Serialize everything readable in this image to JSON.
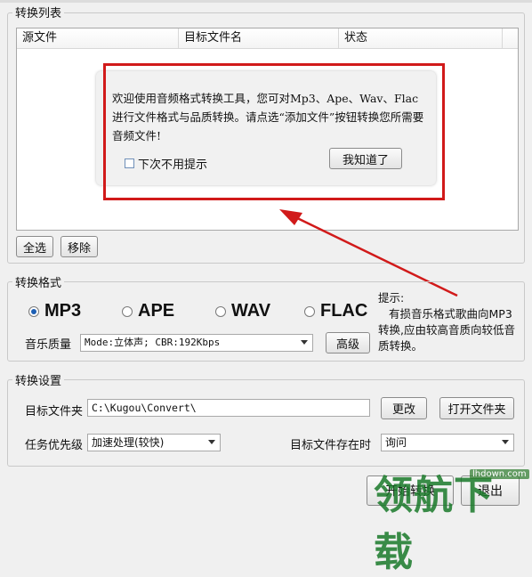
{
  "list_group": {
    "title": "转换列表",
    "columns": [
      "源文件",
      "目标文件名",
      "状态"
    ],
    "select_all_label": "全选",
    "remove_label": "移除"
  },
  "welcome_dialog": {
    "message": "欢迎使用音频格式转换工具，您可对Mp3、Ape、Wav、Flac进行文件格式与品质转换。请点选“添加文件”按钮转换您所需要音频文件!",
    "dont_show_label": "下次不用提示",
    "dont_show_checked": false,
    "ok_label": "我知道了",
    "highlight_color": "#d11a1a"
  },
  "format_group": {
    "title": "转换格式",
    "options": [
      "MP3",
      "APE",
      "WAV",
      "FLAC"
    ],
    "selected": "MP3",
    "quality_label": "音乐质量",
    "quality_value": "Mode:立体声; CBR:192Kbps",
    "advanced_label": "高级",
    "hint_title": "提示:",
    "hint_text": "有损音乐格式歌曲向MP3转换,应由较高音质向较低音质转换。"
  },
  "settings_group": {
    "title": "转换设置",
    "target_folder_label": "目标文件夹",
    "target_folder_value": "C:\\Kugou\\Convert\\",
    "change_label": "更改",
    "open_folder_label": "打开文件夹",
    "priority_label": "任务优先级",
    "priority_value": "加速处理(较快)",
    "exists_label": "目标文件存在时",
    "exists_value": "询问"
  },
  "footer": {
    "start_label": "开始转换",
    "exit_label": "退出"
  },
  "watermark": {
    "text": "领航下载",
    "url": "lhdown.com"
  }
}
